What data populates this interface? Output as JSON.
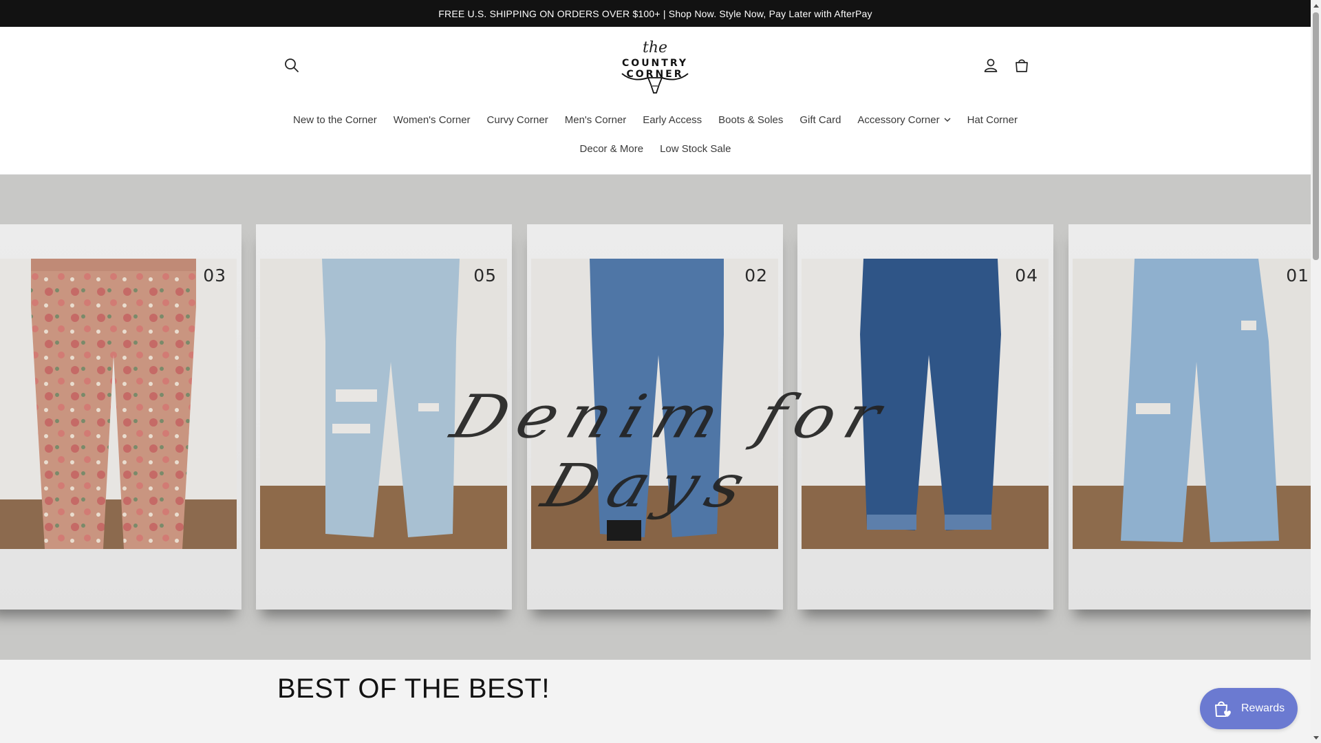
{
  "announcement": {
    "text": "FREE U.S. SHIPPING ON ORDERS OVER $100+ | Shop Now. Style Now, Pay Later with AfterPay"
  },
  "logo": {
    "script": "the",
    "name": "COUNTRY CORNER"
  },
  "header_icons": {
    "search": "search-icon",
    "account": "account-icon",
    "cart": "cart-icon"
  },
  "nav": {
    "row1": [
      {
        "label": "New to the Corner"
      },
      {
        "label": "Women's Corner"
      },
      {
        "label": "Curvy Corner"
      },
      {
        "label": "Men's Corner"
      },
      {
        "label": "Early Access"
      },
      {
        "label": "Boots & Soles"
      },
      {
        "label": "Gift Card"
      },
      {
        "label": "Accessory Corner",
        "has_dropdown": true
      },
      {
        "label": "Hat Corner"
      }
    ],
    "row2": [
      {
        "label": "Decor & More"
      },
      {
        "label": "Low Stock Sale"
      }
    ]
  },
  "hero": {
    "title": "Denim for Days",
    "cards": [
      {
        "number": "03",
        "style": "floral"
      },
      {
        "number": "05",
        "style": "light-ripped"
      },
      {
        "number": "02",
        "style": "medium"
      },
      {
        "number": "04",
        "style": "dark-cuffed"
      },
      {
        "number": "01",
        "style": "light-wide"
      }
    ]
  },
  "section": {
    "heading": "BEST OF THE BEST!"
  },
  "rewards": {
    "label": "Rewards"
  },
  "colors": {
    "announcement_bg": "#121212",
    "hero_bg": "#c8c8c6",
    "rewards_bg": "#6b7ad1"
  }
}
